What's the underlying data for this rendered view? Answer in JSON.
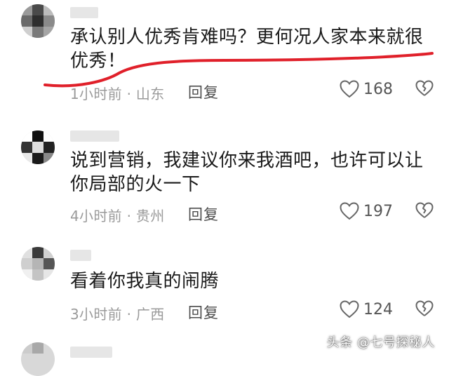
{
  "comments": [
    {
      "text": "承认别人优秀肯难吗？更何况人家本来就很优秀！",
      "meta": "1小时前 · 山东",
      "reply_label": "回复",
      "likes": "168"
    },
    {
      "text": "说到营销，我建议你来我酒吧，也许可以让你局部的火一下",
      "meta": "4小时前 · 贵州",
      "reply_label": "回复",
      "likes": "197"
    },
    {
      "text": "看着你我真的闹腾",
      "meta": "3小时前 · 广西",
      "reply_label": "回复",
      "likes": "124"
    }
  ],
  "watermark": "头条 @七号探秘人",
  "colors": {
    "underline": "#e0202a",
    "meta_text": "#9a9a9a",
    "body_text": "#1a1a1a"
  },
  "icons": {
    "like": "heart-outline-icon",
    "dislike": "broken-heart-icon"
  }
}
